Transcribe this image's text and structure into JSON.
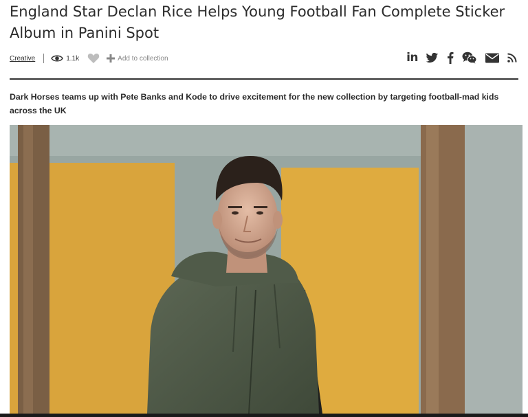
{
  "article": {
    "title": "England Star Declan Rice Helps Young Football Fan Complete Sticker Album in Panini Spot",
    "category": "Creative",
    "views": "1.1k",
    "add_to_collection": "Add to collection",
    "subtitle": "Dark Horses teams up with Pete Banks and Kode to drive excitement for the new collection by targeting football-mad kids across the UK"
  },
  "share_icons": [
    "linkedin-icon",
    "twitter-icon",
    "facebook-icon",
    "wechat-icon",
    "email-icon",
    "rss-icon"
  ],
  "colors": {
    "text": "#2b2b2b",
    "muted": "#888888",
    "wall_yellow": "#e0a93a",
    "wall_teal": "#8fa3a0",
    "jacket_green": "#4f5a48"
  }
}
